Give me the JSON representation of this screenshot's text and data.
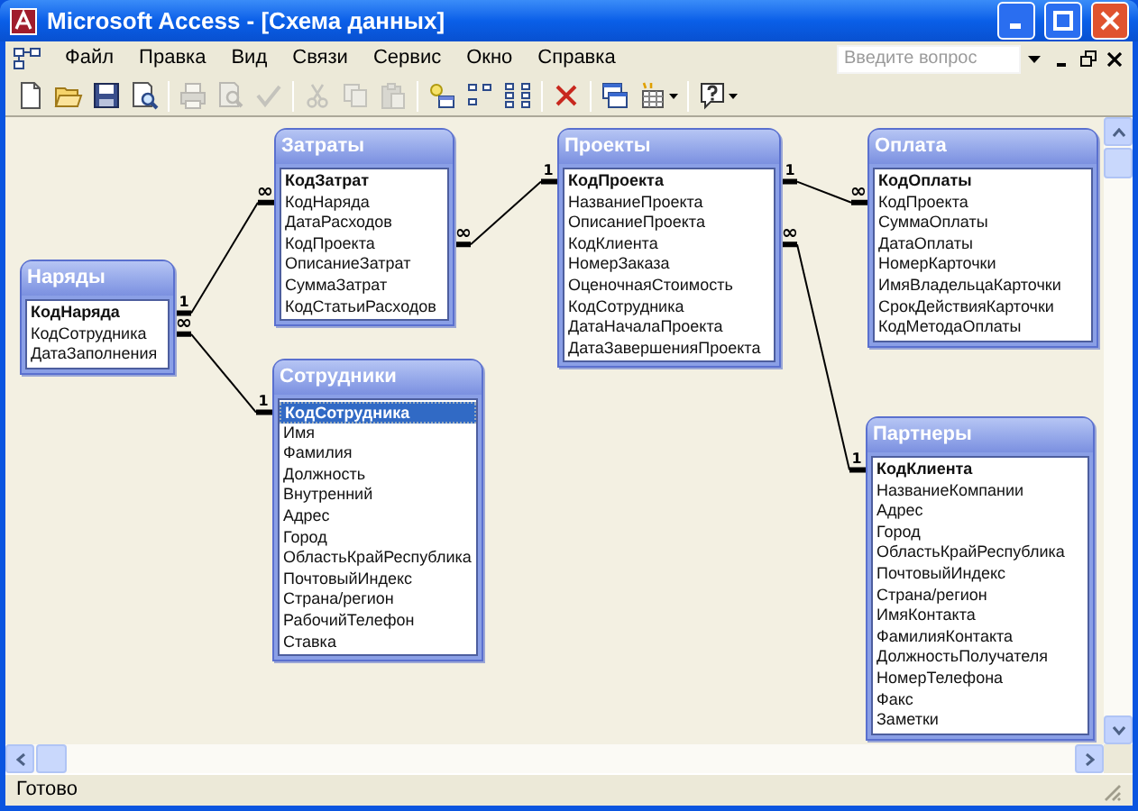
{
  "window": {
    "title": "Microsoft Access - [Схема данных]"
  },
  "menu": {
    "items": [
      "Файл",
      "Правка",
      "Вид",
      "Связи",
      "Сервис",
      "Окно",
      "Справка"
    ],
    "search": {
      "placeholder": "Введите вопрос"
    }
  },
  "toolbar": {
    "buttons": [
      {
        "kind": "new",
        "disabled": false
      },
      {
        "kind": "open",
        "disabled": false
      },
      {
        "kind": "save",
        "disabled": false
      },
      {
        "kind": "file-search",
        "disabled": false
      },
      {
        "kind": "print",
        "disabled": true
      },
      {
        "kind": "print-preview",
        "disabled": true
      },
      {
        "kind": "spelling",
        "disabled": true
      },
      {
        "kind": "cut",
        "disabled": true
      },
      {
        "kind": "copy",
        "disabled": true
      },
      {
        "kind": "paste",
        "disabled": true
      },
      {
        "kind": "show-table",
        "disabled": false
      },
      {
        "kind": "direct-relationships",
        "disabled": false
      },
      {
        "kind": "all-relationships",
        "disabled": false
      },
      {
        "kind": "delete",
        "disabled": false
      },
      {
        "kind": "report",
        "disabled": false
      },
      {
        "kind": "new-object",
        "disabled": false
      },
      {
        "kind": "help",
        "disabled": false
      }
    ]
  },
  "tables": [
    {
      "title": "Наряды",
      "fields": [
        {
          "name": "КодНаряда",
          "key": true,
          "selected": false
        },
        {
          "name": "КодСотрудника",
          "key": false,
          "selected": false
        },
        {
          "name": "ДатаЗаполнения",
          "key": false,
          "selected": false
        }
      ]
    },
    {
      "title": "Затраты",
      "fields": [
        {
          "name": "КодЗатрат",
          "key": true,
          "selected": false
        },
        {
          "name": "КодНаряда",
          "key": false,
          "selected": false
        },
        {
          "name": "ДатаРасходов",
          "key": false,
          "selected": false
        },
        {
          "name": "КодПроекта",
          "key": false,
          "selected": false
        },
        {
          "name": "ОписаниеЗатрат",
          "key": false,
          "selected": false
        },
        {
          "name": "СуммаЗатрат",
          "key": false,
          "selected": false
        },
        {
          "name": "КодСтатьиРасходов",
          "key": false,
          "selected": false
        }
      ]
    },
    {
      "title": "Проекты",
      "fields": [
        {
          "name": "КодПроекта",
          "key": true,
          "selected": false
        },
        {
          "name": "НазваниеПроекта",
          "key": false,
          "selected": false
        },
        {
          "name": "ОписаниеПроекта",
          "key": false,
          "selected": false
        },
        {
          "name": "КодКлиента",
          "key": false,
          "selected": false
        },
        {
          "name": "НомерЗаказа",
          "key": false,
          "selected": false
        },
        {
          "name": "ОценочнаяСтоимость",
          "key": false,
          "selected": false
        },
        {
          "name": "КодСотрудника",
          "key": false,
          "selected": false
        },
        {
          "name": "ДатаНачалаПроекта",
          "key": false,
          "selected": false
        },
        {
          "name": "ДатаЗавершенияПроекта",
          "key": false,
          "selected": false
        }
      ]
    },
    {
      "title": "Оплата",
      "fields": [
        {
          "name": "КодОплаты",
          "key": true,
          "selected": false
        },
        {
          "name": "КодПроекта",
          "key": false,
          "selected": false
        },
        {
          "name": "СуммаОплаты",
          "key": false,
          "selected": false
        },
        {
          "name": "ДатаОплаты",
          "key": false,
          "selected": false
        },
        {
          "name": "НомерКарточки",
          "key": false,
          "selected": false
        },
        {
          "name": "ИмяВладельцаКарточки",
          "key": false,
          "selected": false
        },
        {
          "name": "СрокДействияКарточки",
          "key": false,
          "selected": false
        },
        {
          "name": "КодМетодаОплаты",
          "key": false,
          "selected": false
        }
      ]
    },
    {
      "title": "Сотрудники",
      "fields": [
        {
          "name": "КодСотрудника",
          "key": true,
          "selected": true
        },
        {
          "name": "Имя",
          "key": false,
          "selected": false
        },
        {
          "name": "Фамилия",
          "key": false,
          "selected": false
        },
        {
          "name": "Должность",
          "key": false,
          "selected": false
        },
        {
          "name": "Внутренний",
          "key": false,
          "selected": false
        },
        {
          "name": "Адрес",
          "key": false,
          "selected": false
        },
        {
          "name": "Город",
          "key": false,
          "selected": false
        },
        {
          "name": "ОбластьКрайРеспублика",
          "key": false,
          "selected": false
        },
        {
          "name": "ПочтовыйИндекс",
          "key": false,
          "selected": false
        },
        {
          "name": "Страна/регион",
          "key": false,
          "selected": false
        },
        {
          "name": "РабочийТелефон",
          "key": false,
          "selected": false
        },
        {
          "name": "Ставка",
          "key": false,
          "selected": false
        }
      ]
    },
    {
      "title": "Партнеры",
      "fields": [
        {
          "name": "КодКлиента",
          "key": true,
          "selected": false
        },
        {
          "name": "НазваниеКомпании",
          "key": false,
          "selected": false
        },
        {
          "name": "Адрес",
          "key": false,
          "selected": false
        },
        {
          "name": "Город",
          "key": false,
          "selected": false
        },
        {
          "name": "ОбластьКрайРеспублика",
          "key": false,
          "selected": false
        },
        {
          "name": "ПочтовыйИндекс",
          "key": false,
          "selected": false
        },
        {
          "name": "Страна/регион",
          "key": false,
          "selected": false
        },
        {
          "name": "ИмяКонтакта",
          "key": false,
          "selected": false
        },
        {
          "name": "ФамилияКонтакта",
          "key": false,
          "selected": false
        },
        {
          "name": "ДолжностьПолучателя",
          "key": false,
          "selected": false
        },
        {
          "name": "НомерТелефона",
          "key": false,
          "selected": false
        },
        {
          "name": "Факс",
          "key": false,
          "selected": false
        },
        {
          "name": "Заметки",
          "key": false,
          "selected": false
        }
      ]
    }
  ],
  "relationships": [
    {
      "end_a": "1",
      "end_b": "∞"
    },
    {
      "end_a": "∞",
      "end_b": "1"
    },
    {
      "end_a": "∞",
      "end_b": "1"
    },
    {
      "end_a": "1",
      "end_b": "∞"
    },
    {
      "end_a": "∞",
      "end_b": "1"
    }
  ],
  "status_bar": {
    "text": "Готово"
  }
}
